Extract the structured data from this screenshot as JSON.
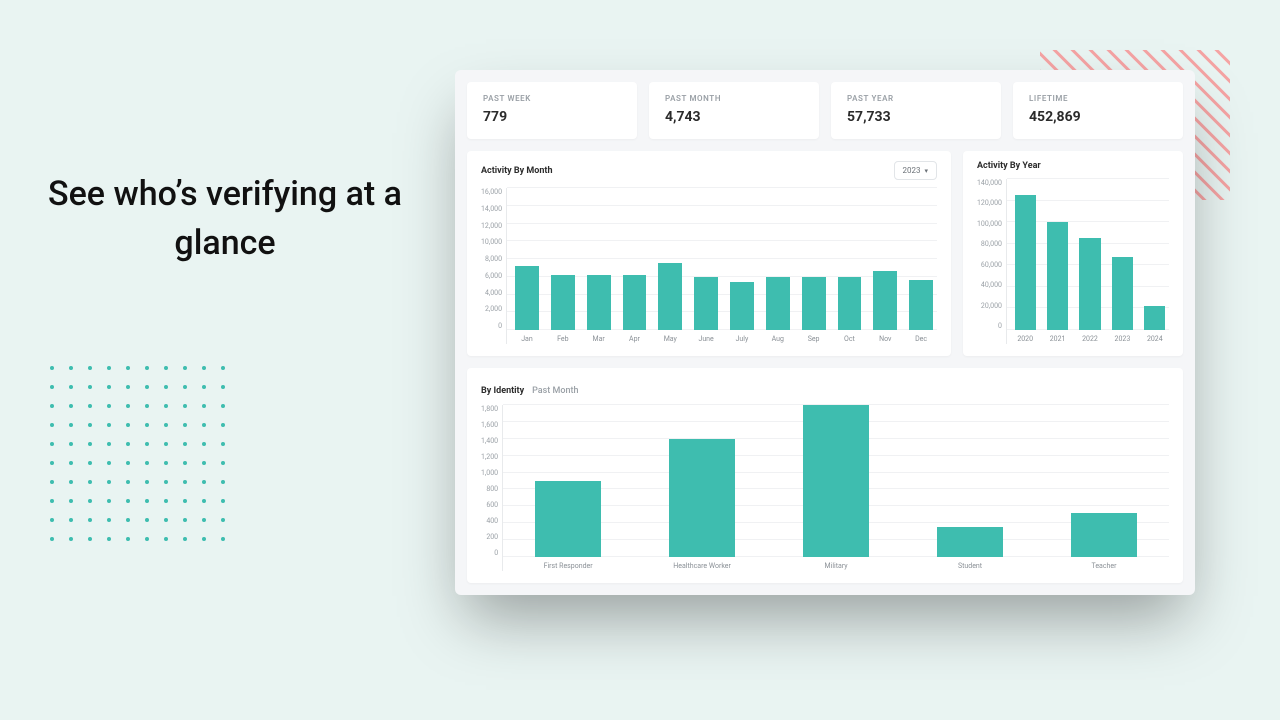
{
  "headline": "See who’s verifying at a glance",
  "stats": [
    {
      "label": "PAST WEEK",
      "value": "779"
    },
    {
      "label": "PAST MONTH",
      "value": "4,743"
    },
    {
      "label": "PAST YEAR",
      "value": "57,733"
    },
    {
      "label": "LIFETIME",
      "value": "452,869"
    }
  ],
  "month_card": {
    "title": "Activity By Month",
    "year_selected": "2023"
  },
  "year_card": {
    "title": "Activity By Year"
  },
  "identity_card": {
    "title": "By Identity",
    "subtitle": "Past Month"
  },
  "chart_data": [
    {
      "type": "bar",
      "title": "Activity By Month",
      "xlabel": "",
      "ylabel": "",
      "ylim": [
        0,
        16000
      ],
      "y_ticks": [
        0,
        2000,
        4000,
        6000,
        8000,
        10000,
        12000,
        14000,
        16000
      ],
      "y_tick_labels": [
        "0",
        "2,000",
        "4,000",
        "6,000",
        "8,000",
        "10,000",
        "12,000",
        "14,000",
        "16,000"
      ],
      "categories": [
        "Jan",
        "Feb",
        "Mar",
        "Apr",
        "May",
        "June",
        "July",
        "Aug",
        "Sep",
        "Oct",
        "Nov",
        "Dec"
      ],
      "values": [
        7200,
        6200,
        6200,
        6200,
        7600,
        6000,
        5400,
        6000,
        6000,
        6000,
        6600,
        5600
      ]
    },
    {
      "type": "bar",
      "title": "Activity By Year",
      "xlabel": "",
      "ylabel": "",
      "ylim": [
        0,
        140000
      ],
      "y_ticks": [
        0,
        20000,
        40000,
        60000,
        80000,
        100000,
        120000,
        140000
      ],
      "y_tick_labels": [
        "0",
        "20,000",
        "40,000",
        "60,000",
        "80,000",
        "100,000",
        "120,000",
        "140,000"
      ],
      "categories": [
        "2020",
        "2021",
        "2022",
        "2023",
        "2024"
      ],
      "values": [
        125000,
        100000,
        85000,
        68000,
        22000
      ]
    },
    {
      "type": "bar",
      "title": "By Identity",
      "xlabel": "",
      "ylabel": "",
      "ylim": [
        0,
        1800
      ],
      "y_ticks": [
        0,
        200,
        400,
        600,
        800,
        1000,
        1200,
        1400,
        1600,
        1800
      ],
      "y_tick_labels": [
        "0",
        "200",
        "400",
        "600",
        "800",
        "1,000",
        "1,200",
        "1,400",
        "1,600",
        "1,800"
      ],
      "categories": [
        "First Responder",
        "Healthcare Worker",
        "Military",
        "Student",
        "Teacher"
      ],
      "values": [
        900,
        1400,
        1800,
        350,
        520
      ]
    }
  ]
}
